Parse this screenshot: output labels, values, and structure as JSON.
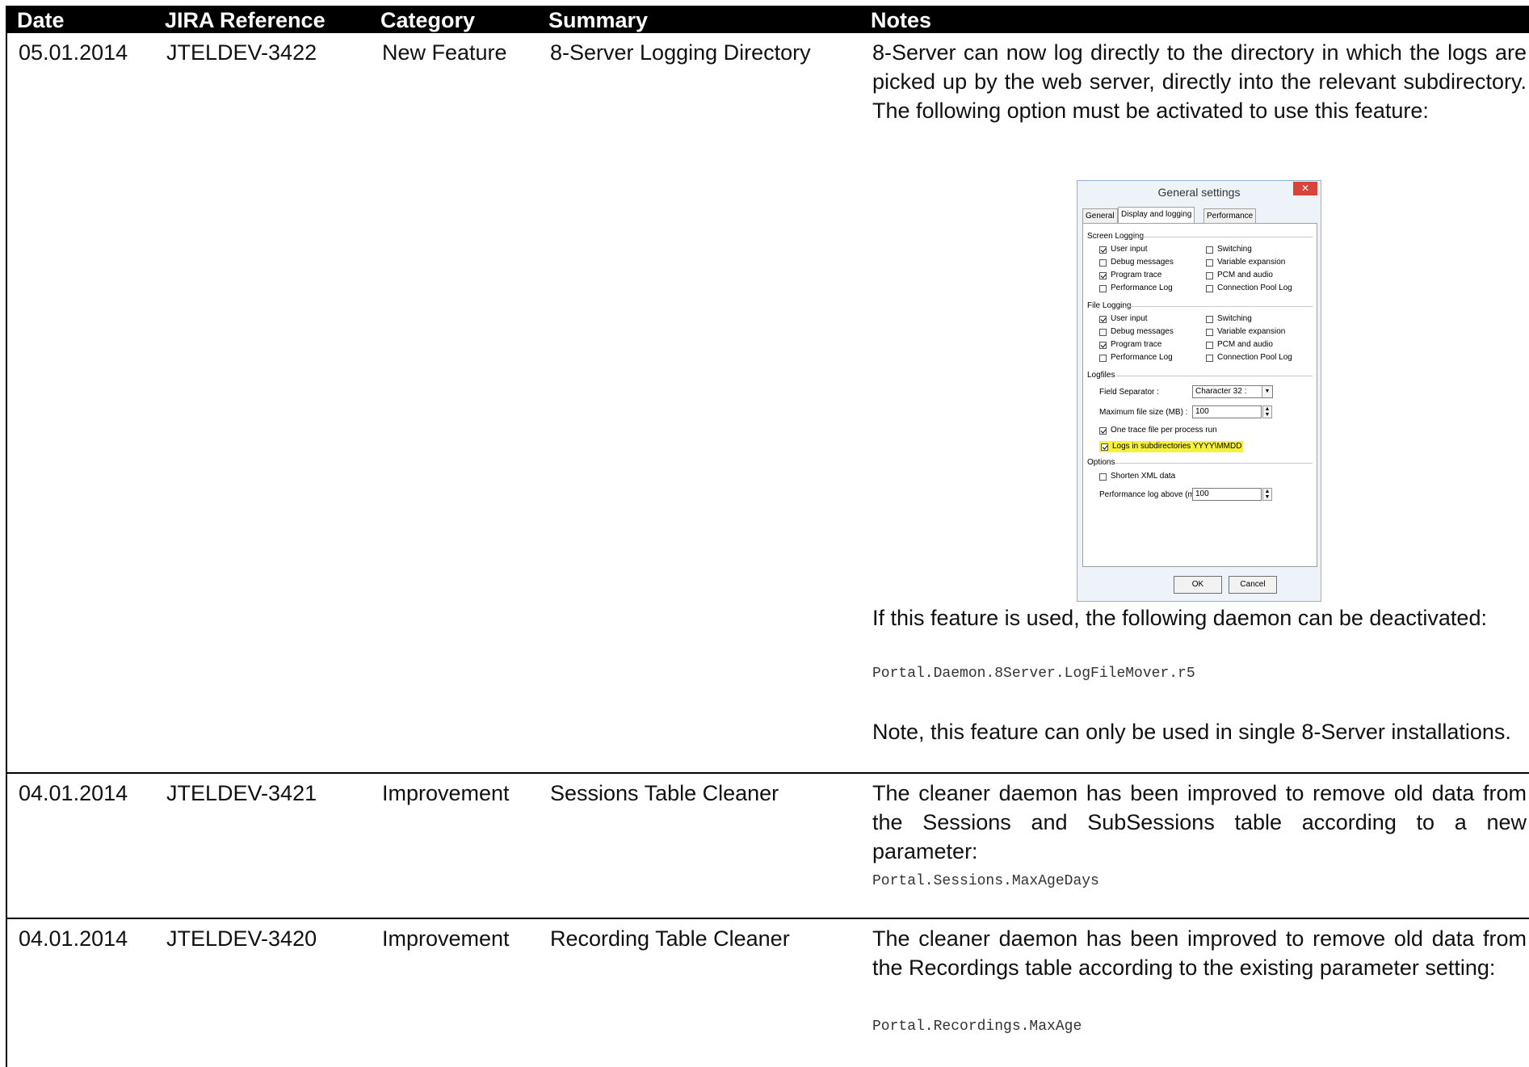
{
  "header": {
    "date": "Date",
    "jira": "JIRA Reference",
    "category": "Category",
    "summary": "Summary",
    "notes": "Notes"
  },
  "rows": [
    {
      "date": "05.01.2014",
      "jira": "JTELDEV-3422",
      "category": "New Feature",
      "summary": "8-Server Logging Directory",
      "notes_intro": "8-Server can now log directly to the directory in which the logs are picked up by the web server, directly into the relevant subdirectory. The following option must be activated to use this feature:",
      "notes_after": "If this feature is used, the following daemon can be deactivated:",
      "code": "Portal.Daemon.8Server.LogFileMover.r5",
      "note_final": "Note, this feature can only be used in single 8-Server installations."
    },
    {
      "date": "04.01.2014",
      "jira": "JTELDEV-3421",
      "category": "Improvement",
      "summary": "Sessions Table Cleaner",
      "notes": "The cleaner daemon has been improved to remove old data from the Sessions and SubSessions table according to a new parameter:",
      "code": "Portal.Sessions.MaxAgeDays"
    },
    {
      "date": "04.01.2014",
      "jira": "JTELDEV-3420",
      "category": "Improvement",
      "summary": "Recording Table Cleaner",
      "notes": "The cleaner daemon has been improved to remove old data from the Recordings table according to the existing parameter setting:",
      "code": "Portal.Recordings.MaxAge"
    }
  ],
  "dialog": {
    "title": "General settings",
    "close_glyph": "✕",
    "tabs": [
      "General",
      "Display and logging",
      "Performance"
    ],
    "active_tab": "Display and logging",
    "screen_logging": {
      "label": "Screen Logging",
      "left": [
        {
          "label": "User input",
          "checked": true
        },
        {
          "label": "Debug messages",
          "checked": false
        },
        {
          "label": "Program trace",
          "checked": true
        },
        {
          "label": "Performance Log",
          "checked": false
        }
      ],
      "right": [
        {
          "label": "Switching",
          "checked": false
        },
        {
          "label": "Variable expansion",
          "checked": false
        },
        {
          "label": "PCM and audio",
          "checked": false
        },
        {
          "label": "Connection Pool Log",
          "checked": false
        }
      ]
    },
    "file_logging": {
      "label": "File Logging",
      "left": [
        {
          "label": "User input",
          "checked": true
        },
        {
          "label": "Debug messages",
          "checked": false
        },
        {
          "label": "Program trace",
          "checked": true
        },
        {
          "label": "Performance Log",
          "checked": false
        }
      ],
      "right": [
        {
          "label": "Switching",
          "checked": false
        },
        {
          "label": "Variable expansion",
          "checked": false
        },
        {
          "label": "PCM and audio",
          "checked": false
        },
        {
          "label": "Connection Pool Log",
          "checked": false
        }
      ]
    },
    "logfiles": {
      "label": "Logfiles",
      "field_separator_label": "Field Separator :",
      "field_separator_value": "Character 32 :",
      "max_size_label": "Maximum file size (MB) :",
      "max_size_value": "100",
      "one_trace_label": "One trace file per process run",
      "one_trace_checked": true,
      "subdirs_label": "Logs in subdirectories YYYY\\MMDD",
      "subdirs_checked": true
    },
    "options": {
      "label": "Options",
      "shorten_xml_label": "Shorten XML data",
      "shorten_xml_checked": false,
      "perf_log_label": "Performance log above (ms) :",
      "perf_log_value": "100"
    },
    "ok_label": "OK",
    "cancel_label": "Cancel",
    "highlight_color": "#f6f23a"
  }
}
